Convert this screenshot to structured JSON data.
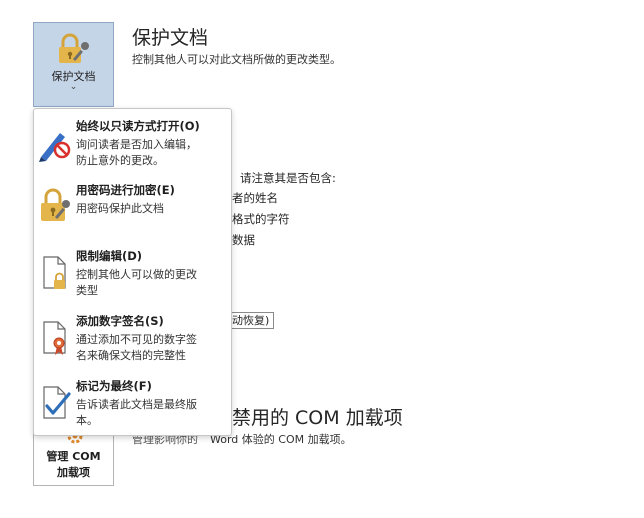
{
  "protect_section": {
    "button_label": "保护文档",
    "chevron": "⌄",
    "title": "保护文档",
    "description": "控制其他人可以对此文档所做的更改类型。"
  },
  "inspect_section": {
    "prompt": "请注意其是否包含:",
    "items": [
      "者的姓名",
      "格式的字符",
      "数据"
    ],
    "recover_button": "动恢复)"
  },
  "com_section": {
    "button_line1": "管理 COM",
    "button_line2": "加载项",
    "title": "禁用的 COM 加载项",
    "description_prefix": "管理影响你的",
    "description": "Word 体验的 COM 加载项。"
  },
  "menu": {
    "items": [
      {
        "title": "始终以只读方式打开(O)",
        "desc_line1": "询问读者是否加入编辑，",
        "desc_line2": "防止意外的更改。",
        "icon": "read-only-pen-icon"
      },
      {
        "title": "用密码进行加密(E)",
        "desc_line1": "用密码保护此文档",
        "desc_line2": "",
        "icon": "lock-key-icon"
      },
      {
        "title": "限制编辑(D)",
        "desc_line1": "控制其他人可以做的更改",
        "desc_line2": "类型",
        "icon": "document-lock-icon"
      },
      {
        "title": "添加数字签名(S)",
        "desc_line1": "通过添加不可见的数字签",
        "desc_line2": "名来确保文档的完整性",
        "icon": "document-ribbon-icon"
      },
      {
        "title": "标记为最终(F)",
        "desc_line1": "告诉读者此文档是最终版",
        "desc_line2": "本。",
        "icon": "document-check-icon"
      }
    ]
  }
}
